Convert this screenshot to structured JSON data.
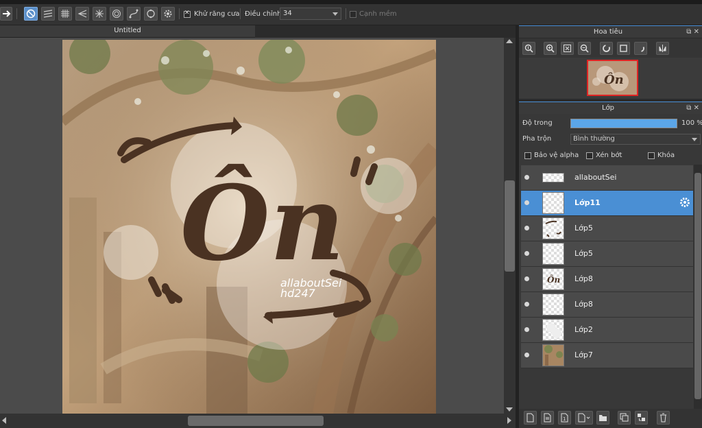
{
  "toolbar": {
    "antialias_label": "Khử răng cưa",
    "adjust_label": "Điều chỉnh",
    "adjust_value": "34",
    "soft_edge_label": "Cạnh mềm",
    "antialias_checked": true,
    "soft_edge_checked": false
  },
  "canvas": {
    "tab_title": "Untitled",
    "logo_text": "Ôn",
    "watermark_line1": "allaboutSei",
    "watermark_line2": "hd247"
  },
  "navigator": {
    "title": "Hoa tiêu",
    "thumb_text": "Ôn"
  },
  "layers_panel": {
    "title": "Lớp",
    "opacity_label": "Độ trong",
    "opacity_value": "100 %",
    "opacity_fraction": 1.0,
    "blend_label": "Pha trộn",
    "blend_value": "Bình thường",
    "protect_alpha_label": "Bảo vệ alpha",
    "clipping_label": "Xén bớt",
    "lock_label": "Khóa",
    "layers": [
      {
        "name": "allaboutSei",
        "selected": false,
        "thumb": "text"
      },
      {
        "name": "Lớp11",
        "selected": true,
        "thumb": "empty"
      },
      {
        "name": "Lớp5",
        "selected": false,
        "thumb": "marks"
      },
      {
        "name": "Lớp5",
        "selected": false,
        "thumb": "empty"
      },
      {
        "name": "Lớp8",
        "selected": false,
        "thumb": "logo"
      },
      {
        "name": "Lớp8",
        "selected": false,
        "thumb": "empty"
      },
      {
        "name": "Lớp2",
        "selected": false,
        "thumb": "circles"
      },
      {
        "name": "Lớp7",
        "selected": false,
        "thumb": "photo"
      }
    ],
    "layer_thumb_logo_text": "Ôn"
  },
  "colors": {
    "accent": "#4a8fd4",
    "logo_brown": "#4a3222",
    "nav_frame": "#e02424"
  }
}
